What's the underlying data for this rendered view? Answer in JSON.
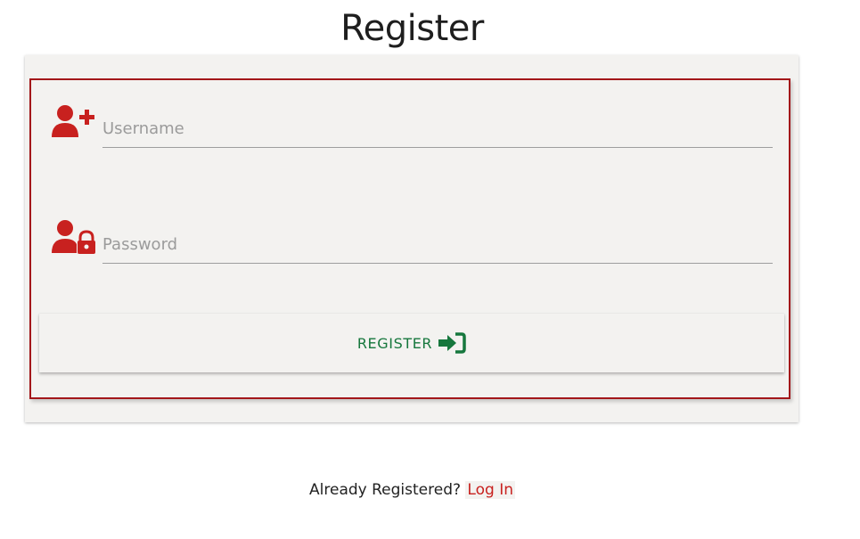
{
  "page": {
    "title": "Register"
  },
  "form": {
    "username": {
      "placeholder": "Username",
      "value": "",
      "icon": "user-plus-icon"
    },
    "password": {
      "placeholder": "Password",
      "value": "",
      "icon": "user-lock-icon"
    },
    "submit": {
      "label": "REGISTER",
      "icon": "sign-in-icon"
    }
  },
  "footer": {
    "prompt": "Already Registered?",
    "link_label": "Log In"
  },
  "colors": {
    "accent_red": "#c8211f",
    "border_red": "#a3171a",
    "button_green": "#16773d",
    "card_bg": "#f3f2f0"
  }
}
